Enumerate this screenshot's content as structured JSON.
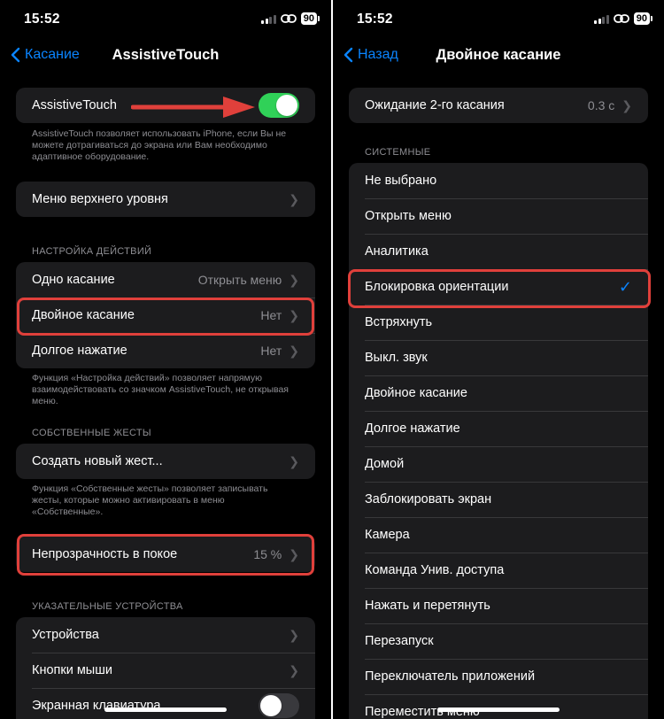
{
  "left": {
    "status": {
      "time": "15:52",
      "battery": "90"
    },
    "nav": {
      "back_label": "Касание",
      "title": "AssistiveTouch"
    },
    "assistive": {
      "label": "AssistiveTouch",
      "enabled": true,
      "footer": "AssistiveTouch позволяет использовать iPhone, если Вы не можете дотрагиваться до экрана или Вам необходимо адаптивное оборудование."
    },
    "top_menu": {
      "label": "Меню верхнего уровня"
    },
    "actions": {
      "header": "НАСТРОЙКА ДЕЙСТВИЙ",
      "single": {
        "label": "Одно касание",
        "value": "Открыть меню"
      },
      "double": {
        "label": "Двойное касание",
        "value": "Нет"
      },
      "long": {
        "label": "Долгое нажатие",
        "value": "Нет"
      },
      "footer": "Функция «Настройка действий» позволяет напрямую взаимодействовать со значком AssistiveTouch, не открывая меню."
    },
    "gestures": {
      "header": "СОБСТВЕННЫЕ ЖЕСТЫ",
      "create": {
        "label": "Создать новый жест..."
      },
      "footer": "Функция «Собственные жесты» позволяет записывать жесты, которые можно активировать в меню «Собственные»."
    },
    "opacity": {
      "label": "Непрозрачность в покое",
      "value": "15 %"
    },
    "pointer": {
      "header": "УКАЗАТЕЛЬНЫЕ УСТРОЙСТВА",
      "devices": {
        "label": "Устройства"
      },
      "mouse": {
        "label": "Кнопки мыши"
      },
      "keyboard": {
        "label": "Экранная клавиатура",
        "enabled": false
      }
    }
  },
  "right": {
    "status": {
      "time": "15:52",
      "battery": "90"
    },
    "nav": {
      "back_label": "Назад",
      "title": "Двойное касание"
    },
    "timeout": {
      "label": "Ожидание 2-го касания",
      "value": "0.3 с"
    },
    "system": {
      "header": "СИСТЕМНЫЕ",
      "items": [
        "Не выбрано",
        "Открыть меню",
        "Аналитика",
        "Блокировка ориентации",
        "Встряхнуть",
        "Выкл. звук",
        "Двойное касание",
        "Долгое нажатие",
        "Домой",
        "Заблокировать экран",
        "Камера",
        "Команда Унив. доступа",
        "Нажать и перетянуть",
        "Перезапуск",
        "Переключатель приложений",
        "Переместить меню"
      ],
      "selected": "Блокировка ориентации"
    }
  },
  "colors": {
    "accent": "#0a84ff",
    "toggle_on": "#30d158",
    "highlight": "#e0403b",
    "panel_bg": "#000000",
    "cell_bg": "#1c1c1e"
  }
}
